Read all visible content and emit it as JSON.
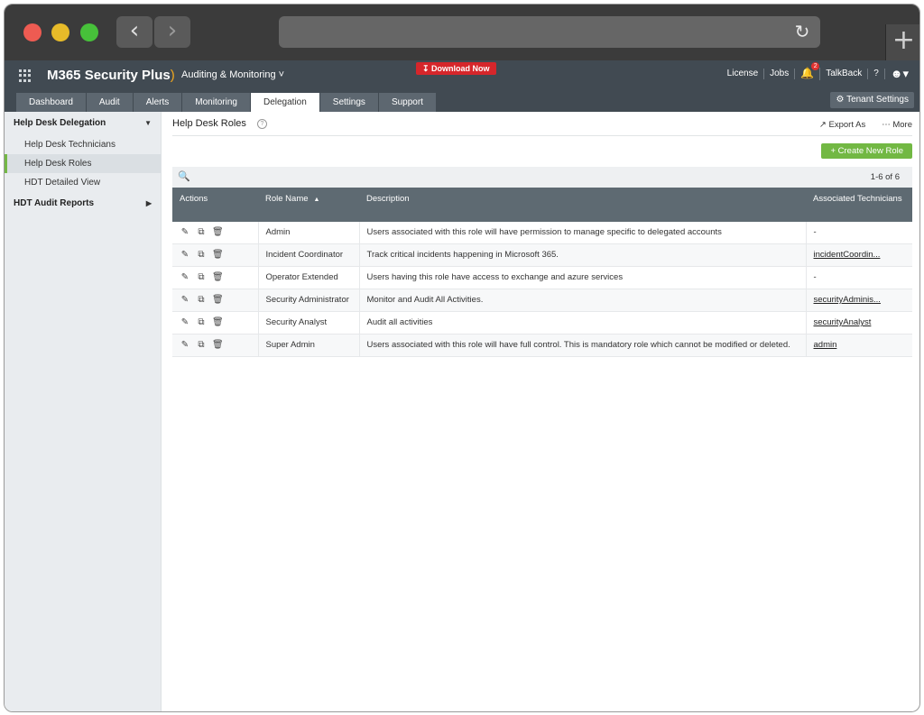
{
  "app": {
    "brand": "M365 Security Plus",
    "module": "Auditing & Monitoring",
    "download_label": "Download Now",
    "top_links": [
      "License",
      "Jobs",
      "TalkBack",
      "?"
    ],
    "notification_count": "2",
    "accent_color": "#72b843"
  },
  "tabs": [
    "Dashboard",
    "Audit",
    "Alerts",
    "Monitoring",
    "Delegation",
    "Settings",
    "Support"
  ],
  "active_tab": "Delegation",
  "tenant_settings_label": "Tenant Settings",
  "sidebar": {
    "group1": "Help Desk Delegation",
    "items": [
      "Help Desk Technicians",
      "Help Desk Roles",
      "HDT Detailed View"
    ],
    "group2": "HDT Audit Reports"
  },
  "main": {
    "title": "Help Desk Roles",
    "export_label": "Export As",
    "more_label": "More",
    "create_label": "Create New Role",
    "pager": "1-6 of 6"
  },
  "table": {
    "headers": {
      "actions": "Actions",
      "role": "Role Name",
      "description": "Description",
      "technicians": "Associated Technicians"
    },
    "rows": [
      {
        "role": "Admin",
        "description": "Users associated with this role will have permission to manage specific to delegated accounts",
        "tech": "-",
        "link": false
      },
      {
        "role": "Incident Coordinator",
        "description": "Track critical incidents happening in Microsoft 365.",
        "tech": "incidentCoordin...",
        "link": true
      },
      {
        "role": "Operator Extended",
        "description": "Users having this role have access to exchange and azure services",
        "tech": "-",
        "link": false
      },
      {
        "role": "Security Administrator",
        "description": "Monitor and Audit All Activities.",
        "tech": "securityAdminis...",
        "link": true
      },
      {
        "role": "Security Analyst",
        "description": "Audit all activities",
        "tech": "securityAnalyst",
        "link": true
      },
      {
        "role": "Super Admin",
        "description": "Users associated with this role will have full control. This is mandatory role which cannot be modified or deleted.",
        "tech": "admin",
        "link": true
      }
    ]
  }
}
